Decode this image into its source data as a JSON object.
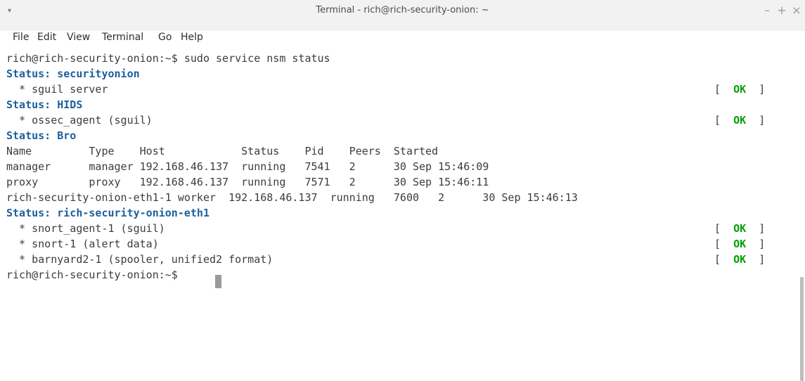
{
  "window": {
    "title": "Terminal - rich@rich-security-onion: ~",
    "menu_arrow": "▾",
    "controls": {
      "minimize": "–",
      "maximize": "+",
      "close": "×"
    }
  },
  "menu": {
    "file": "File",
    "edit": "Edit",
    "view": "View",
    "terminal": "Terminal",
    "go": "Go",
    "help": "Help"
  },
  "terminal": {
    "command_line": "rich@rich-security-onion:~$ sudo service nsm status",
    "prompt": "rich@rich-security-onion:~$ ",
    "ok_bracket": "[  OK  ]",
    "ok_open": "[  ",
    "ok_word": "OK",
    "ok_close": "  ]",
    "status_securityonion": "Status: securityonion",
    "sguil_server": "  * sguil server",
    "status_hids": "Status: HIDS",
    "ossec_agent": "  * ossec_agent (sguil)",
    "status_bro": "Status: Bro",
    "bro_header": "Name         Type    Host            Status    Pid    Peers  Started",
    "bro_rows": [
      "manager      manager 192.168.46.137  running   7541   2      30 Sep 15:46:09",
      "proxy        proxy   192.168.46.137  running   7571   2      30 Sep 15:46:11",
      "rich-security-onion-eth1-1 worker  192.168.46.137  running   7600   2      30 Sep 15:46:13"
    ],
    "status_eth1": "Status: rich-security-onion-eth1",
    "snort_agent": "  * snort_agent-1 (sguil)",
    "snort": "  * snort-1 (alert data)",
    "barnyard": "  * barnyard2-1 (spooler, unified2 format)"
  }
}
